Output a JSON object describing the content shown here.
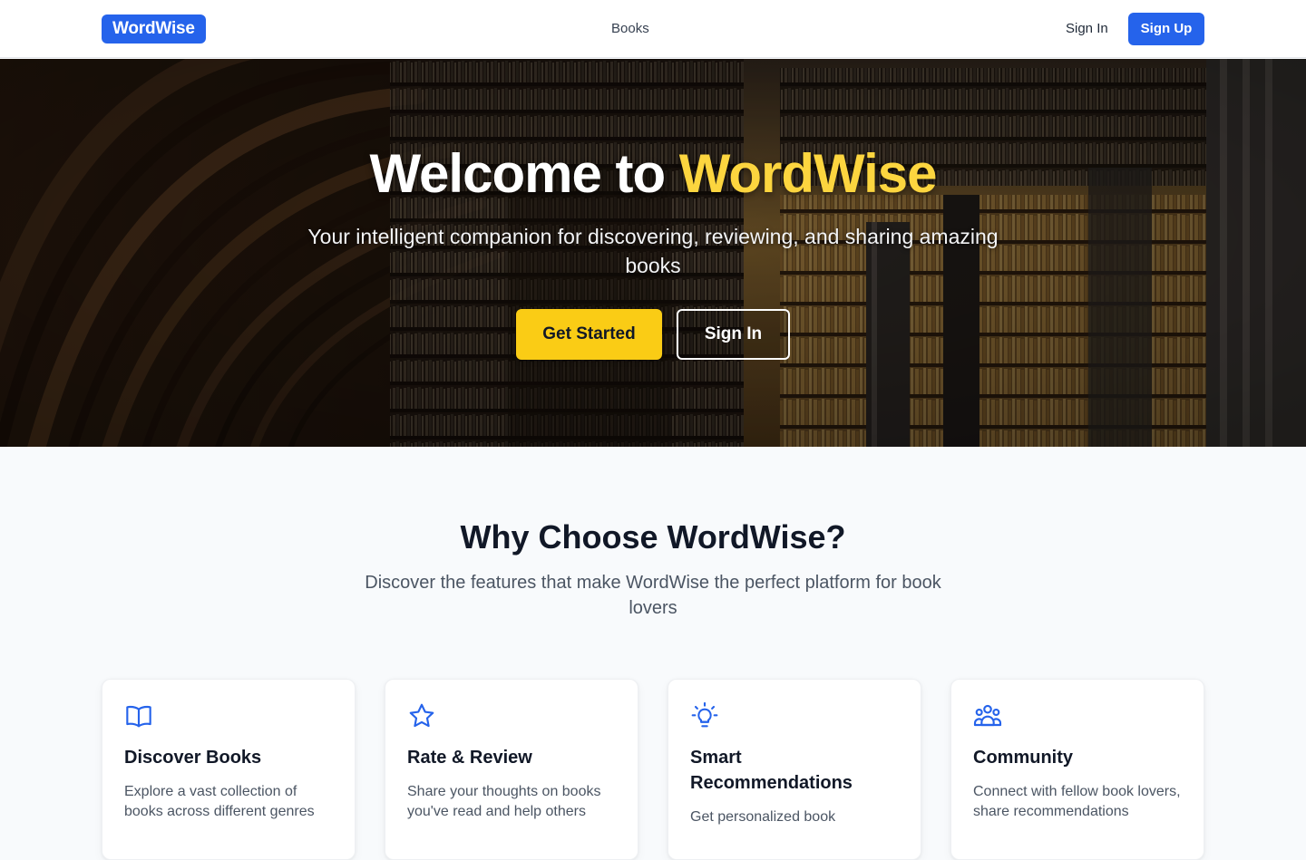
{
  "nav": {
    "logo": "WordWise",
    "books": "Books",
    "sign_in": "Sign In",
    "sign_up": "Sign Up"
  },
  "hero": {
    "title_prefix": "Welcome to ",
    "title_accent": "WordWise",
    "subtitle": "Your intelligent companion for discovering, reviewing, and sharing amazing books",
    "primary_button": "Get Started",
    "secondary_button": "Sign In"
  },
  "features": {
    "title": "Why Choose WordWise?",
    "subtitle": "Discover the features that make WordWise the perfect platform for book lovers",
    "cards": [
      {
        "icon": "open-book-icon",
        "title": "Discover Books",
        "desc": "Explore a vast collection of books across different genres"
      },
      {
        "icon": "star-icon",
        "title": "Rate & Review",
        "desc": "Share your thoughts on books you've read and help others"
      },
      {
        "icon": "lightbulb-icon",
        "title": "Smart Recommendations",
        "desc": "Get personalized book"
      },
      {
        "icon": "users-icon",
        "title": "Community",
        "desc": "Connect with fellow book lovers, share recommendations"
      }
    ]
  },
  "colors": {
    "primary": "#2563eb",
    "accent": "#facc15",
    "page_bg": "#f8fafc"
  }
}
